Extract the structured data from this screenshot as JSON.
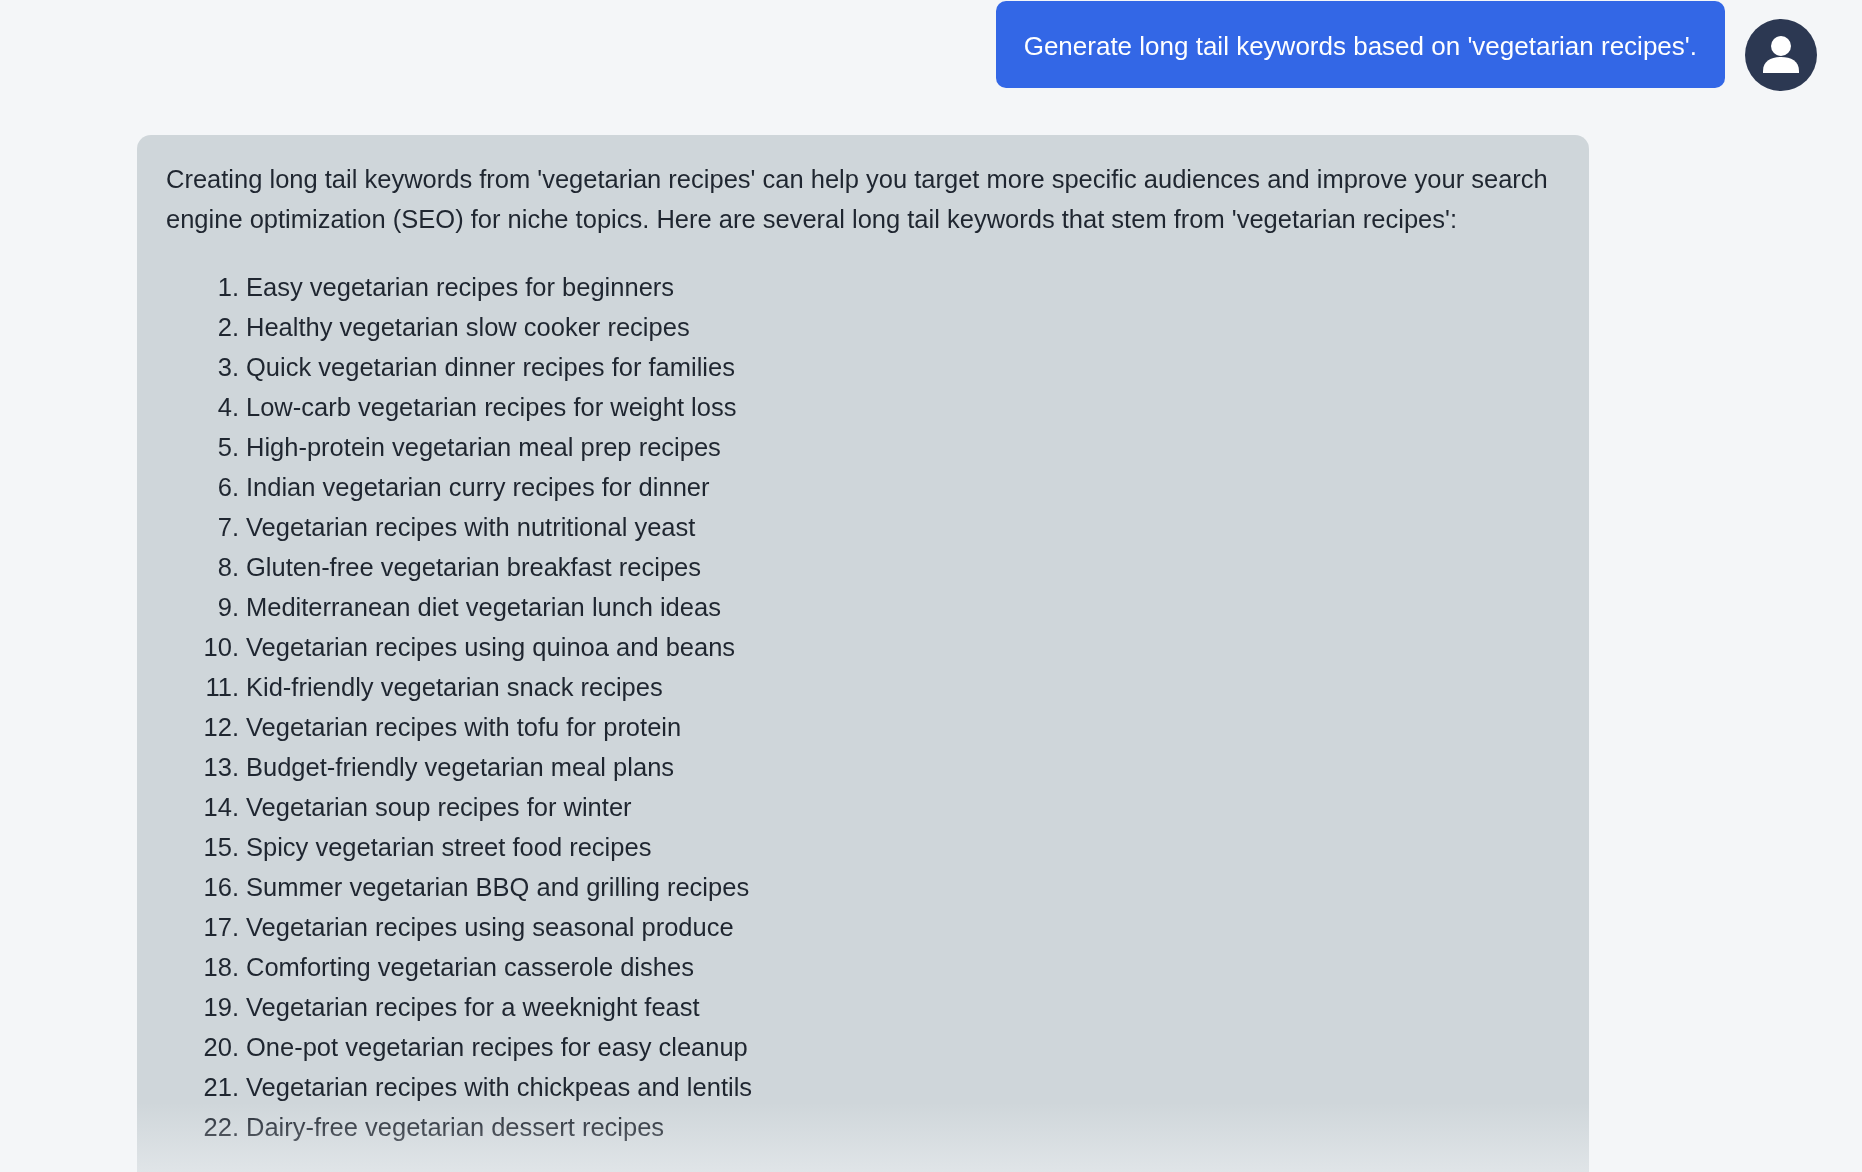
{
  "user_message": {
    "text": "Generate long tail keywords based on 'vegetarian recipes'."
  },
  "assistant_message": {
    "intro": "Creating long tail keywords from 'vegetarian recipes' can help you target more specific audiences and improve your search engine optimization (SEO) for niche topics. Here are several long tail keywords that stem from 'vegetarian recipes':",
    "items": [
      {
        "number": "1.",
        "text": "Easy vegetarian recipes for beginners"
      },
      {
        "number": "2.",
        "text": "Healthy vegetarian slow cooker recipes"
      },
      {
        "number": "3.",
        "text": "Quick vegetarian dinner recipes for families"
      },
      {
        "number": "4.",
        "text": "Low-carb vegetarian recipes for weight loss"
      },
      {
        "number": "5.",
        "text": "High-protein vegetarian meal prep recipes"
      },
      {
        "number": "6.",
        "text": "Indian vegetarian curry recipes for dinner"
      },
      {
        "number": "7.",
        "text": "Vegetarian recipes with nutritional yeast"
      },
      {
        "number": "8.",
        "text": "Gluten-free vegetarian breakfast recipes"
      },
      {
        "number": "9.",
        "text": "Mediterranean diet vegetarian lunch ideas"
      },
      {
        "number": "10.",
        "text": "Vegetarian recipes using quinoa and beans"
      },
      {
        "number": "11.",
        "text": "Kid-friendly vegetarian snack recipes"
      },
      {
        "number": "12.",
        "text": "Vegetarian recipes with tofu for protein"
      },
      {
        "number": "13.",
        "text": "Budget-friendly vegetarian meal plans"
      },
      {
        "number": "14.",
        "text": "Vegetarian soup recipes for winter"
      },
      {
        "number": "15.",
        "text": "Spicy vegetarian street food recipes"
      },
      {
        "number": "16.",
        "text": "Summer vegetarian BBQ and grilling recipes"
      },
      {
        "number": "17.",
        "text": "Vegetarian recipes using seasonal produce"
      },
      {
        "number": "18.",
        "text": "Comforting vegetarian casserole dishes"
      },
      {
        "number": "19.",
        "text": "Vegetarian recipes for a weeknight feast"
      },
      {
        "number": "20.",
        "text": "One-pot vegetarian recipes for easy cleanup"
      },
      {
        "number": "21.",
        "text": "Vegetarian recipes with chickpeas and lentils"
      },
      {
        "number": "22.",
        "text": "Dairy-free vegetarian dessert recipes"
      }
    ]
  }
}
